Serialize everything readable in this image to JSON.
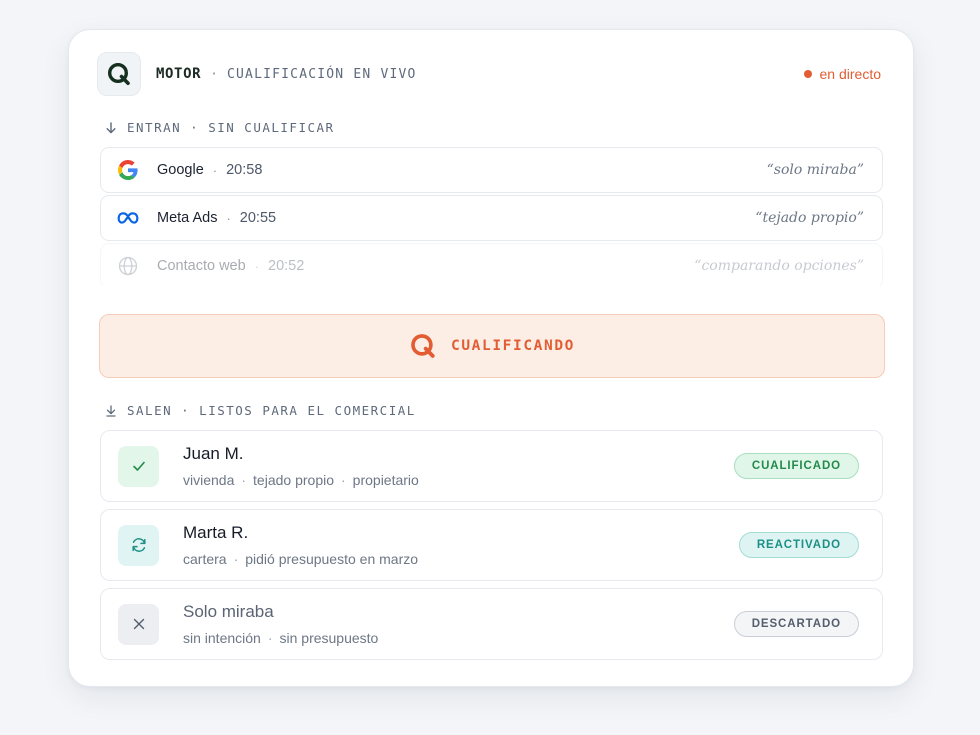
{
  "header": {
    "brand": "MOTOR",
    "separator": "·",
    "subtitle": "CUALIFICACIÓN EN VIVO",
    "live_label": "en directo",
    "logo_icon": "q-logo-icon"
  },
  "incoming": {
    "label_prefix": "ENTRAN",
    "label_separator": "·",
    "label_suffix": "SIN CUALIFICAR",
    "items": [
      {
        "source": "Google",
        "time": "20:58",
        "quote": "“solo miraba”",
        "icon": "google-icon"
      },
      {
        "source": "Meta Ads",
        "time": "20:55",
        "quote": "“tejado propio”",
        "icon": "meta-icon"
      },
      {
        "source": "Contacto web",
        "time": "20:52",
        "quote": "“comparando opciones”",
        "icon": "globe-icon"
      }
    ]
  },
  "qualifying": {
    "label": "CUALIFICANDO",
    "icon": "q-logo-icon"
  },
  "outgoing": {
    "label_prefix": "SALEN",
    "label_separator": "·",
    "label_suffix": "LISTOS PARA EL COMERCIAL",
    "items": [
      {
        "name": "Juan M.",
        "meta": [
          "vivienda",
          "tejado propio",
          "propietario"
        ],
        "badge": "CUALIFICADO",
        "icon": "check-icon"
      },
      {
        "name": "Marta R.",
        "meta": [
          "cartera",
          "pidió presupuesto en marzo"
        ],
        "badge": "REACTIVADO",
        "icon": "refresh-icon"
      },
      {
        "name": "Solo miraba",
        "meta": [
          "sin intención",
          "sin presupuesto"
        ],
        "badge": "DESCARTADO",
        "icon": "close-icon"
      }
    ]
  },
  "colors": {
    "accent": "#e25d33",
    "logo_green": "#16301f",
    "qualified": "#238a4b",
    "reactivated": "#1d8f86",
    "discarded": "#545e6d"
  }
}
